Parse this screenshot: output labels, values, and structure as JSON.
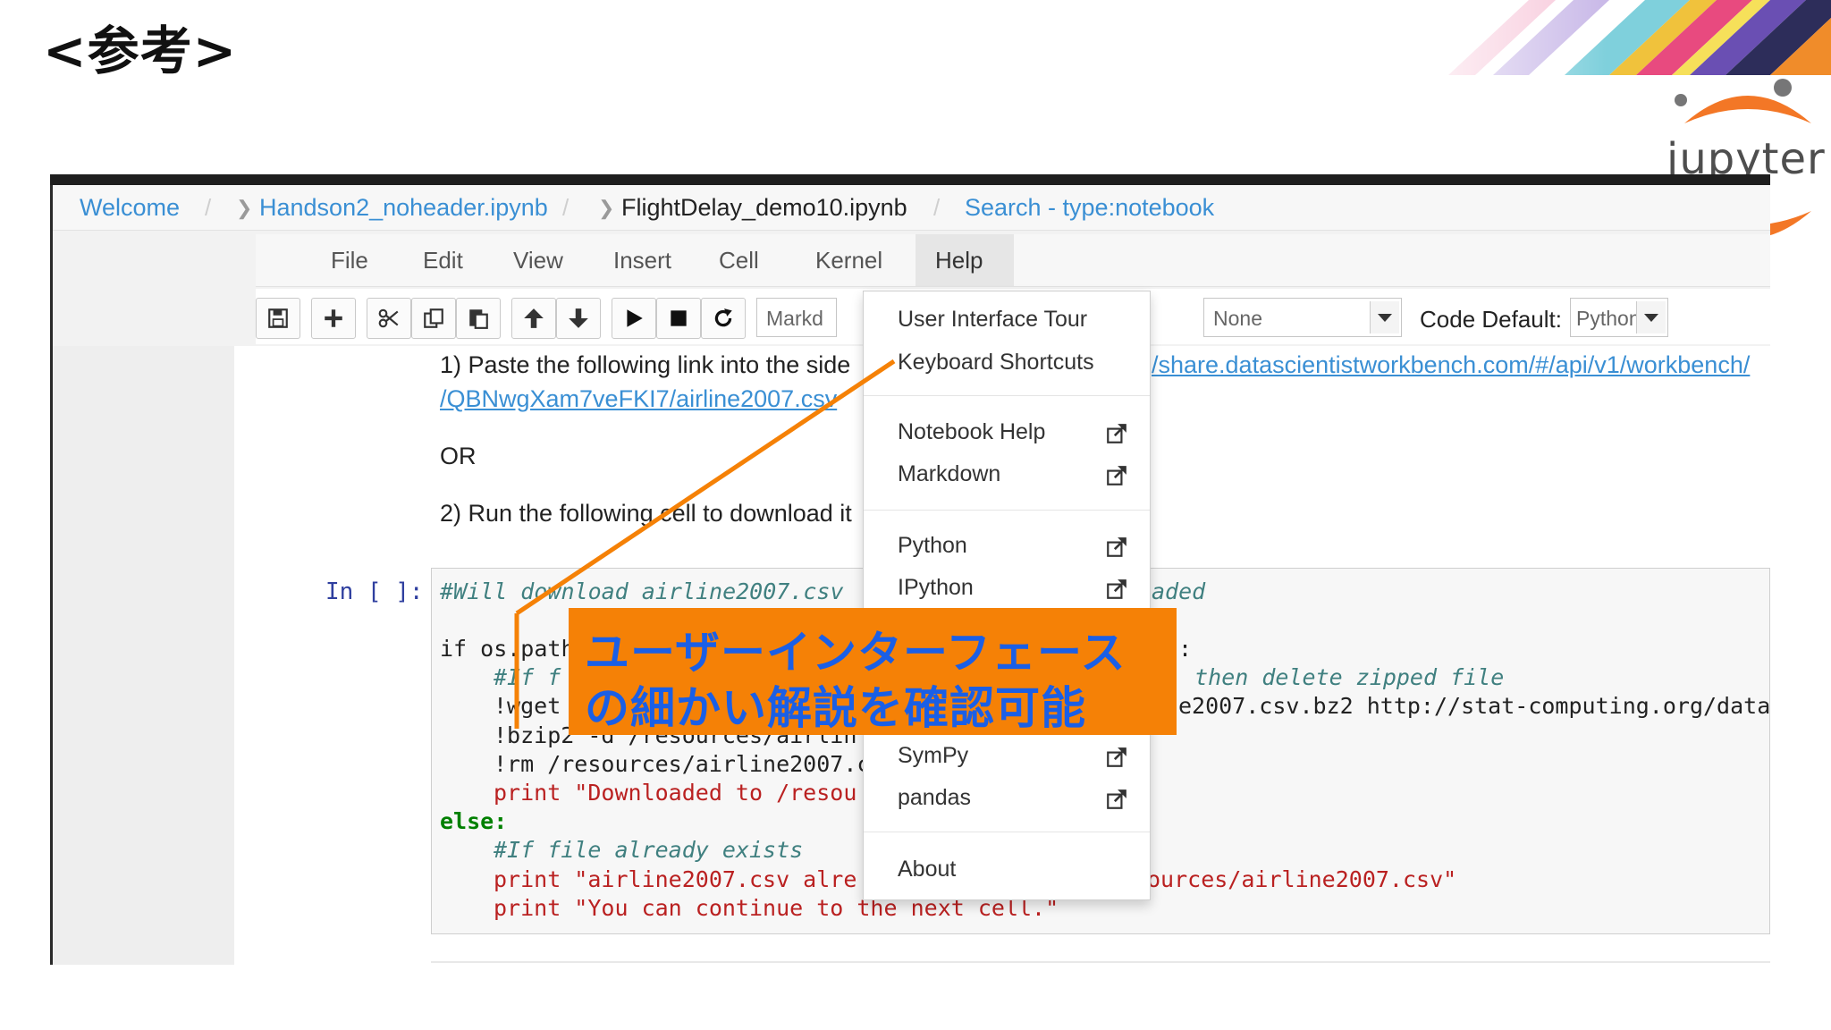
{
  "slide": {
    "title": "<参考>",
    "logo_text": "jupyter"
  },
  "breadcrumb": {
    "items": [
      "Welcome",
      "Handson2_noheader.ipynb",
      "FlightDelay_demo10.ipynb",
      "Search - type:notebook"
    ],
    "separator": "/"
  },
  "menubar": {
    "items": [
      "File",
      "Edit",
      "View",
      "Insert",
      "Cell",
      "Kernel",
      "Help"
    ],
    "active": "Help"
  },
  "toolbar": {
    "icons": [
      "save-icon",
      "plus-icon",
      "cut-icon",
      "copy-icon",
      "paste-icon",
      "arrow-up-icon",
      "arrow-down-icon",
      "run-icon",
      "stop-icon",
      "restart-icon"
    ],
    "cell_type_value": "Markd",
    "celltoolbar_value": "None",
    "code_default_label": "Code Default:",
    "code_default_value": "Python"
  },
  "markdown_cell": {
    "line1": "1) Paste the following link into the side",
    "link1": "/share.datascientistworkbench.com/#/api/v1/workbench/",
    "link2": "/QBNwgXam7veFKI7/airline2007.csv",
    "or_text": "OR",
    "line2": "2) Run the following cell to download it"
  },
  "code_cell": {
    "prompt": "In [ ]:",
    "lines": [
      "#Will download airline2007.csv",
      "aded",
      "if os.path",
      ":",
      "#If f",
      ", then delete zipped file",
      "!wget",
      "e2007.csv.bz2 http://stat-computing.org/data",
      "!bzip2 -d /resources/airlin",
      "!rm /resources/airline2007.c",
      "print \"Downloaded to /resou",
      "else:",
      "#If file already exists",
      "print \"airline2007.csv alre",
      "ources/airline2007.csv\"",
      "print \"You can continue to the next cell.\""
    ]
  },
  "help_menu": {
    "items": [
      {
        "label": "User Interface Tour",
        "external": false
      },
      {
        "label": "Keyboard Shortcuts",
        "external": false
      },
      {
        "label": "Notebook Help",
        "external": true
      },
      {
        "label": "Markdown",
        "external": true
      },
      {
        "label": "Python",
        "external": true
      },
      {
        "label": "IPython",
        "external": true
      },
      {
        "label": "SymPy",
        "external": true
      },
      {
        "label": "pandas",
        "external": true
      },
      {
        "label": "About",
        "external": false
      }
    ]
  },
  "callout": {
    "line1": "ユーザーインターフェース",
    "line2": "の細かい解説を確認可能"
  },
  "colors": {
    "link": "#3a8fd4",
    "callout_bg": "#f58106",
    "callout_text": "#1a5fe6",
    "leader_line": "#f58106"
  }
}
